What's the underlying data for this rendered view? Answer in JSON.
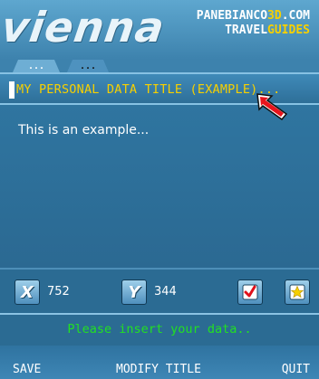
{
  "header": {
    "logo": "vienna",
    "brand_line1_pre": "PANEBIANCO",
    "brand_line1_accent": "3D",
    "brand_line1_post": ".COM",
    "brand_line2_pre": "TRAVEL",
    "brand_line2_accent": "GUIDES"
  },
  "tabs": [
    {
      "label": "..."
    },
    {
      "label": "..."
    }
  ],
  "title_field": {
    "value": "MY PERSONAL DATA TITLE (EXAMPLE)..."
  },
  "content": {
    "text": "This is an example..."
  },
  "coords": {
    "x_label": "X",
    "x_value": "752",
    "y_label": "Y",
    "y_value": "344"
  },
  "status": {
    "message": "Please insert your data.."
  },
  "softkeys": {
    "left": "SAVE",
    "center": "MODIFY TITLE",
    "right": "QUIT"
  },
  "colors": {
    "accent_yellow": "#f6d000",
    "status_green": "#22e022",
    "background_blue": "#2f6e95"
  },
  "icons": {
    "pointer": "arrow-cursor-icon",
    "check": "checkmark-icon",
    "star": "star-icon"
  }
}
